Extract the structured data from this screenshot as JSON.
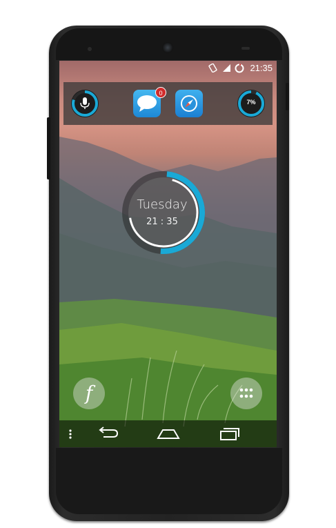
{
  "status_bar": {
    "time": "21:35",
    "icons": [
      "screen-rotation-icon",
      "signal-icon",
      "battery-icon"
    ]
  },
  "dock": {
    "items": [
      {
        "name": "voice-search",
        "icon": "microphone-icon",
        "progress_fraction": 0.8
      },
      {
        "name": "messages",
        "icon": "chat-bubble-icon",
        "badge": "0"
      },
      {
        "name": "browser",
        "icon": "compass-icon"
      },
      {
        "name": "battery",
        "label": "7%",
        "progress_fraction": 0.07
      }
    ]
  },
  "clock_widget": {
    "day": "Tuesday",
    "time": "21 : 35",
    "progress_fraction": 0.48
  },
  "home": {
    "left_button_icon": "facebook-f-icon",
    "left_button_label": "f",
    "right_button_icon": "app-drawer-icon"
  },
  "nav_bar": {
    "items": [
      "menu-icon",
      "back-icon",
      "home-icon",
      "recents-icon"
    ]
  },
  "colors": {
    "accent": "#1aa9d6",
    "ring_track": "#2a2a2a",
    "badge": "#d22b2b"
  }
}
